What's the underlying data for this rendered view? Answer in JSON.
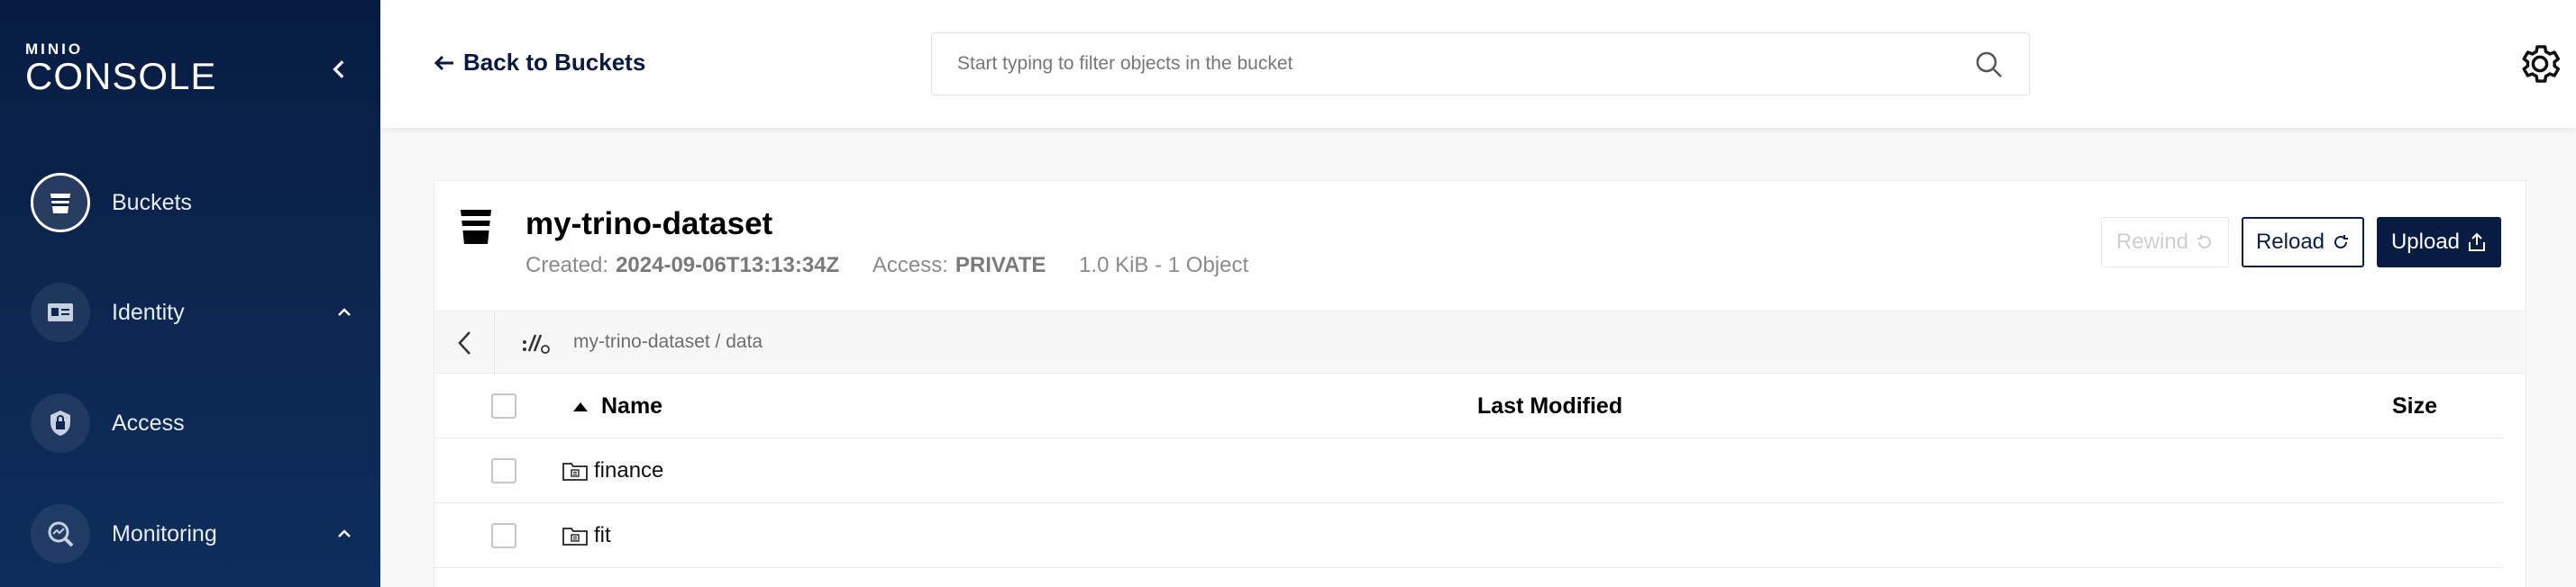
{
  "brand": {
    "small": "MINIO",
    "big": "CONSOLE"
  },
  "sidebar": {
    "items": [
      {
        "label": "Buckets",
        "icon": "bucket-icon",
        "active": true
      },
      {
        "label": "Identity",
        "icon": "id-card-icon",
        "expandable": true
      },
      {
        "label": "Access",
        "icon": "lock-shield-icon"
      },
      {
        "label": "Monitoring",
        "icon": "monitoring-search-icon",
        "expandable": true
      }
    ]
  },
  "topbar": {
    "back_label": "Back to Buckets",
    "search_placeholder": "Start typing to filter objects in the bucket"
  },
  "bucket": {
    "name": "my-trino-dataset",
    "created_label": "Created:",
    "created_value": "2024-09-06T13:13:34Z",
    "access_label": "Access:",
    "access_value": "PRIVATE",
    "usage": "1.0 KiB - 1 Object"
  },
  "actions": {
    "rewind": "Rewind",
    "reload": "Reload",
    "upload": "Upload"
  },
  "path": "my-trino-dataset / data",
  "table": {
    "columns": [
      "Name",
      "Last Modified",
      "Size"
    ],
    "rows": [
      {
        "name": "finance",
        "last_modified": "",
        "size": ""
      },
      {
        "name": "fit",
        "last_modified": "",
        "size": ""
      }
    ]
  },
  "colors": {
    "sidebar": "#081c42",
    "primary": "#081c42",
    "text_muted": "#8a8a8a"
  }
}
